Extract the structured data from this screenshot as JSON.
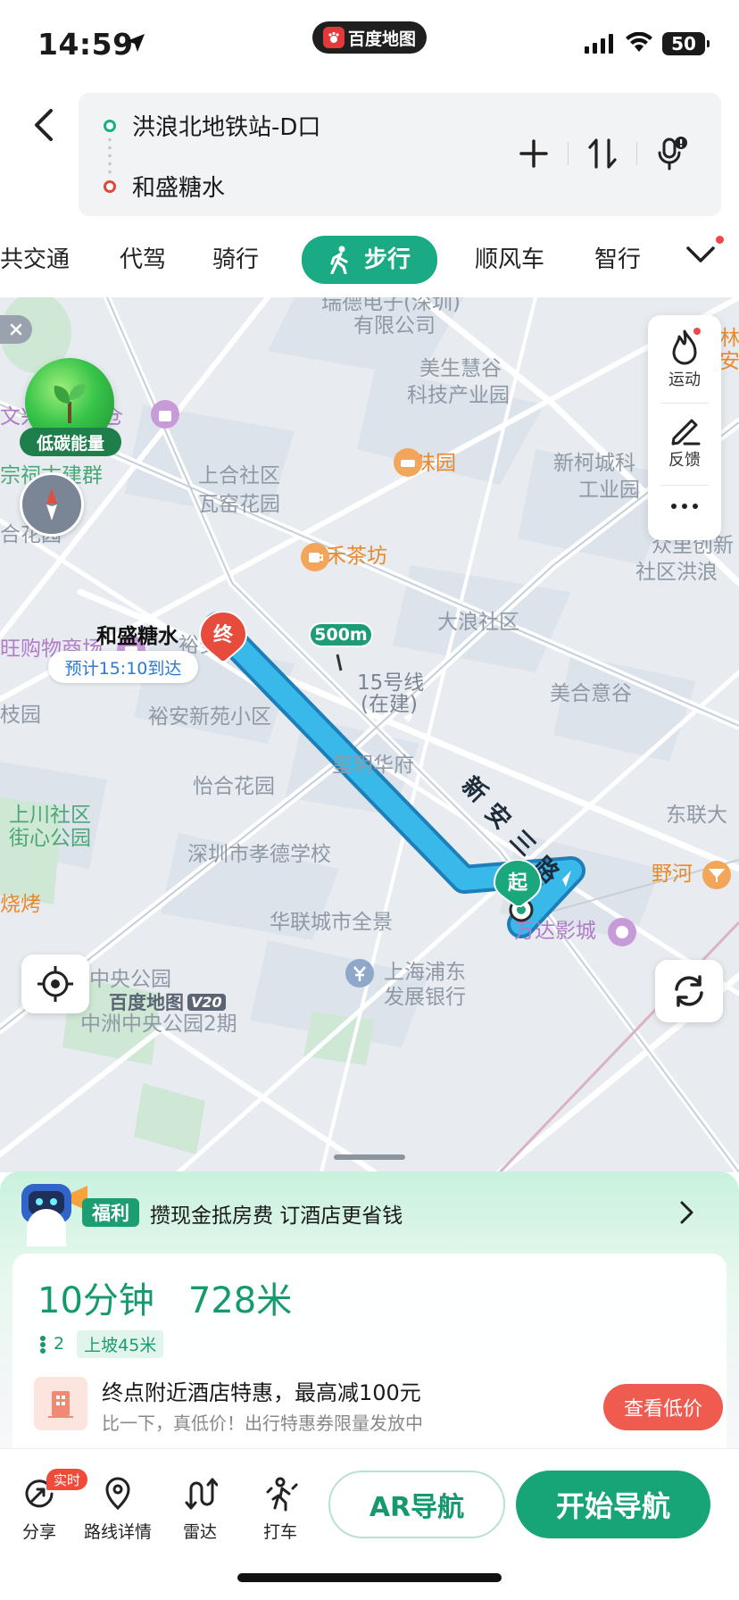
{
  "status": {
    "time": "14:59",
    "app_pill": "百度地图",
    "battery": "50"
  },
  "route": {
    "from": "洪浪北地铁站-D口",
    "to": "和盛糖水"
  },
  "modes": {
    "items": [
      "共交通",
      "代驾",
      "骑行",
      "步行",
      "顺风车",
      "智行"
    ],
    "active": "步行"
  },
  "map": {
    "energy_label": "低碳能量",
    "side_actions": {
      "sport": "运动",
      "feedback": "反馈"
    },
    "end_marker": "终",
    "start_marker": "起",
    "end_name": "和盛糖水",
    "eta": "预计15:10到达",
    "distance_marker": "500m",
    "road_name": [
      "新",
      "安",
      "三",
      "路"
    ],
    "logo": "百度地图",
    "logo_version": "V20",
    "labels": [
      "瑞德电子(深圳)",
      "有限公司",
      "美生慧谷",
      "科技产业园",
      "馨味园",
      "新柯城科",
      "工业园",
      "上合社区",
      "瓦窑花园",
      "吉禾茶坊",
      "众里创新",
      "社区洪浪",
      "大浪社区",
      "裕安居",
      "15号线",
      "(在建)",
      "美合意谷",
      "裕安新苑小区",
      "玺玥华府",
      "怡合花园",
      "东联大",
      "深圳市孝德学校",
      "野河",
      "华联城市全景",
      "万达影城",
      "中央公园",
      "上海浦东",
      "发展银行",
      "中洲中央公园2期",
      "文兴源批发仓",
      "宗祠古建群",
      "合花园",
      "旺购物商场",
      "枝园",
      "上川社区",
      "街心公园",
      "烧烤",
      "林",
      "安"
    ]
  },
  "sheet": {
    "promo_tag": "福利",
    "promo_text": "攒现金抵房费 订酒店更省钱",
    "duration": "10分钟",
    "distance": "728米",
    "lights": "2",
    "slope": "上坡45米",
    "hotel_title": "终点附近酒店特惠，最高减100元",
    "hotel_sub": "比一下，真低价！出行特惠券限量发放中",
    "hotel_button": "查看低价"
  },
  "nav": {
    "share": "分享",
    "live_badge": "实时",
    "details": "路线详情",
    "radar": "雷达",
    "taxi": "打车",
    "ar": "AR导航",
    "start": "开始导航"
  },
  "colors": {
    "accent": "#17a578",
    "route": "#39b8ea",
    "end_pin": "#e74b3c",
    "promo_red": "#ef5b4e"
  }
}
